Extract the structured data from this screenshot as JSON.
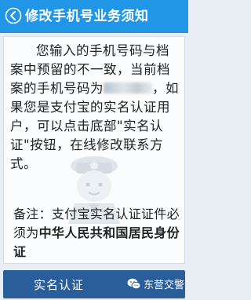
{
  "header": {
    "title": "修改手机号业务须知"
  },
  "notice": {
    "paragraph_before": "您输入的手机号码与档案中预留的不一致，当前档案的手机号码为",
    "masked_phone": "1**********",
    "paragraph_after": "，如果您是支付宝的实名认证用户，可以点击底部\"实名认证\"按钮，在线修改联系方式。",
    "note_prefix": "备注：支付宝实名认证证件必须为",
    "note_bold": "中华人民共和国居民身份证"
  },
  "footer": {
    "button_label": "实名认证",
    "watermark_text": "东营交警"
  },
  "colors": {
    "header_bg": "#2196e6",
    "button_bg": "#2a5e9a",
    "page_bg": "#e9eef4"
  },
  "icons": {
    "back": "back-arrow-circle-icon",
    "watermark": "wechat-logo-icon",
    "mascot": "police-mascot-icon"
  }
}
